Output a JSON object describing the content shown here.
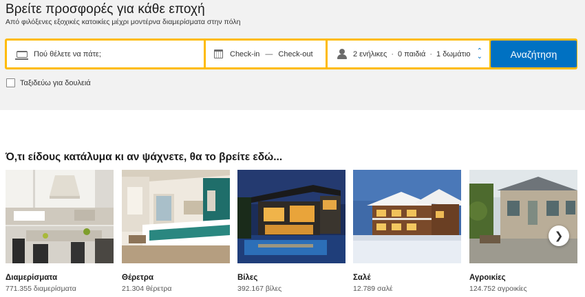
{
  "hero": {
    "title": "Βρείτε προσφορές για κάθε εποχή",
    "subtitle": "Από φιλόξενες εξοχικές κατοικίες μέχρι μοντέρνα διαμερίσματα στην πόλη"
  },
  "search": {
    "destination_placeholder": "Πού θέλετε να πάτε;",
    "checkin_label": "Check-in",
    "date_separator": "—",
    "checkout_label": "Check-out",
    "adults": "2 ενήλικες",
    "separator": "·",
    "children": "0 παιδιά",
    "rooms": "1 δωμάτιο",
    "button_label": "Αναζήτηση"
  },
  "business_travel": {
    "label": "Ταξιδεύω για δουλειά",
    "checked": false
  },
  "section": {
    "title": "Ό,τι είδους κατάλυμα κι αν ψάχνετε, θα το βρείτε εδώ..."
  },
  "property_types": [
    {
      "name": "Διαμερίσματα",
      "count": "771.355 διαμερίσματα"
    },
    {
      "name": "Θέρετρα",
      "count": "21.304 θέρετρα"
    },
    {
      "name": "Βίλες",
      "count": "392.167 βίλες"
    },
    {
      "name": "Σαλέ",
      "count": "12.789 σαλέ"
    },
    {
      "name": "Αγροικίες",
      "count": "124.752 αγροικίες"
    }
  ],
  "icons": {
    "destination": "bed-icon",
    "dates": "calendar-icon",
    "guests": "person-icon",
    "guests_selector": "updown-chevron-icon",
    "carousel_next": "chevron-right-icon"
  },
  "colors": {
    "search_border": "#febb02",
    "primary_button": "#0071c2",
    "hero_background": "#f2f2f2"
  }
}
